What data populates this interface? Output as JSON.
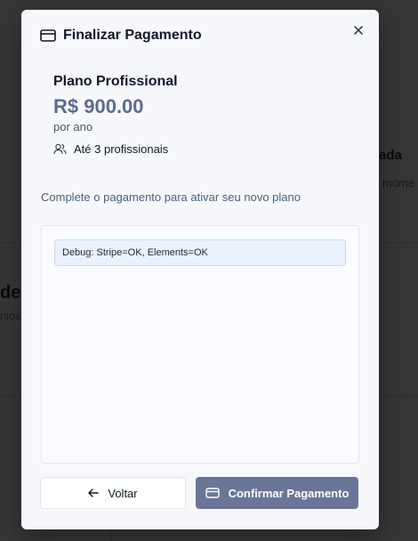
{
  "background": {
    "heading_fragment_1": "ada",
    "muted_fragment_1": "mome",
    "heading_fragment_2": "de",
    "muted_fragment_2": "rsos"
  },
  "modal": {
    "title": "Finalizar Pagamento",
    "title_icon": "credit-card-icon",
    "close_icon": "close-icon",
    "plan": {
      "name": "Plano Profissional",
      "price": "R$ 900.00",
      "period": "por ano",
      "feature_icon": "users-icon",
      "feature": "Até 3 profissionais"
    },
    "instruction": "Complete o pagamento para ativar seu novo plano",
    "debug_text": "Debug: Stripe=OK, Elements=OK",
    "back_button": {
      "label": "Voltar",
      "icon": "arrow-left-icon"
    },
    "confirm_button": {
      "label": "Confirmar Pagamento",
      "icon": "credit-card-icon"
    }
  },
  "colors": {
    "accent": "#6b7597",
    "price": "#5f6b8c",
    "debug_bg": "#e9f2fd",
    "modal_bg": "#f7f8fc"
  }
}
